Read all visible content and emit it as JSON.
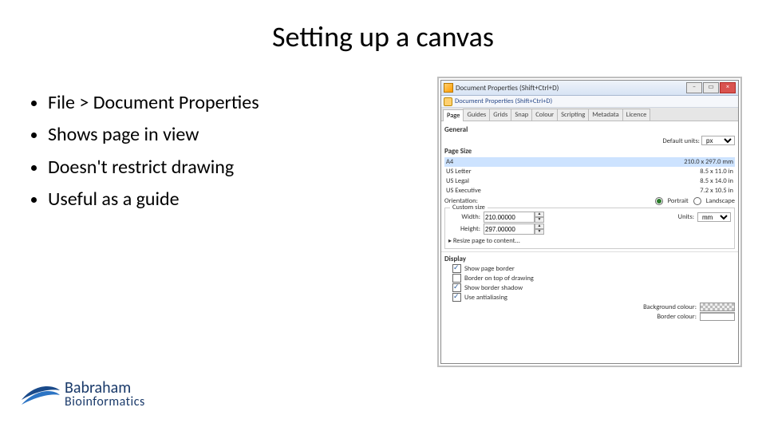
{
  "title": "Setting up a canvas",
  "bullets": [
    "File > Document Properties",
    "Shows page in view",
    "Doesn't restrict drawing",
    "Useful as a guide"
  ],
  "logo": {
    "top": "Babraham",
    "bottom": "Bioinformatics"
  },
  "dialog": {
    "window_title": "Document Properties (Shift+Ctrl+D)",
    "shortcut_label": "Document Properties (Shift+Ctrl+D)",
    "tabs": [
      "Page",
      "Guides",
      "Grids",
      "Snap",
      "Colour",
      "Scripting",
      "Metadata",
      "Licence"
    ],
    "general": {
      "heading": "General",
      "default_units_label": "Default units:",
      "default_units_value": "px"
    },
    "page_size": {
      "heading": "Page Size",
      "rows": [
        {
          "name": "A4",
          "dim": "210.0 x 297.0 mm",
          "selected": true
        },
        {
          "name": "US Letter",
          "dim": "8.5 x 11.0 in",
          "selected": false
        },
        {
          "name": "US Legal",
          "dim": "8.5 x 14.0 in",
          "selected": false
        },
        {
          "name": "US Executive",
          "dim": "7.2 x 10.5 in",
          "selected": false
        }
      ],
      "orientation_label": "Orientation:",
      "orientation_portrait": "Portrait",
      "orientation_landscape": "Landscape",
      "custom_legend": "Custom size",
      "width_label": "Width:",
      "width_value": "210.00000",
      "height_label": "Height:",
      "height_value": "297.00000",
      "units_label": "Units:",
      "units_value": "mm",
      "resize_expander": "Resize page to content..."
    },
    "display": {
      "heading": "Display",
      "show_border": "Show page border",
      "border_on_top": "Border on top of drawing",
      "show_shadow": "Show border shadow",
      "antialias": "Use antialiasing",
      "bg_label": "Background colour:",
      "border_colour_label": "Border colour:"
    }
  }
}
